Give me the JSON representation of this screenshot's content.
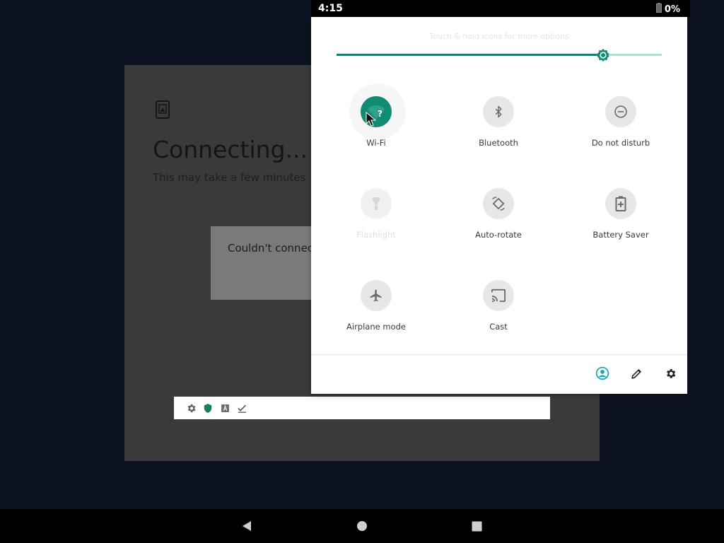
{
  "status_bar": {
    "time": "4:15",
    "battery_percent": "0%"
  },
  "background_app": {
    "title": "Connecting...",
    "subtitle": "This may take a few minutes",
    "dialog_text": "Couldn't connect"
  },
  "quick_settings": {
    "hint": "Touch & hold icons for more options",
    "brightness_level": 0.82,
    "accent_color": "#128b75",
    "tiles": [
      {
        "label": "Wi-Fi",
        "icon": "wifi-icon",
        "state": "active"
      },
      {
        "label": "Bluetooth",
        "icon": "bluetooth-icon",
        "state": "off"
      },
      {
        "label": "Do not disturb",
        "icon": "do-not-disturb-icon",
        "state": "off"
      },
      {
        "label": "Flashlight",
        "icon": "flashlight-icon",
        "state": "disabled"
      },
      {
        "label": "Auto-rotate",
        "icon": "auto-rotate-icon",
        "state": "off"
      },
      {
        "label": "Battery Saver",
        "icon": "battery-saver-icon",
        "state": "off"
      },
      {
        "label": "Airplane mode",
        "icon": "airplane-icon",
        "state": "off"
      },
      {
        "label": "Cast",
        "icon": "cast-icon",
        "state": "off"
      }
    ],
    "footer_icons": [
      "user-icon",
      "edit-icon",
      "settings-icon"
    ]
  },
  "toolbar_icons": [
    "gear-icon",
    "shield-icon",
    "text-icon",
    "checklist-icon"
  ],
  "nav_icons": [
    "back-icon",
    "home-icon",
    "recents-icon"
  ]
}
